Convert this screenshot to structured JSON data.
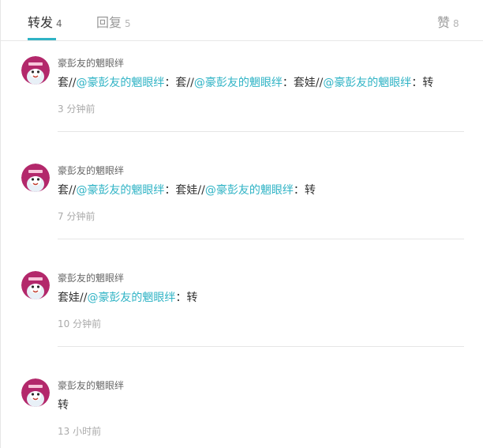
{
  "tabs": {
    "forward": {
      "label": "转发",
      "count": "4"
    },
    "reply": {
      "label": "回复",
      "count": "5"
    },
    "like": {
      "label": "赞",
      "count": "8"
    }
  },
  "accent_color": "#2fb3c5",
  "items": [
    {
      "username": "豪彭友的魍眼绊",
      "content": [
        {
          "t": "text",
          "v": "套//"
        },
        {
          "t": "mention",
          "v": "@豪彭友的魍眼绊"
        },
        {
          "t": "text",
          "v": "：套//"
        },
        {
          "t": "mention",
          "v": "@豪彭友的魍眼绊"
        },
        {
          "t": "text",
          "v": "：套娃//"
        },
        {
          "t": "mention",
          "v": "@豪彭友的魍眼绊"
        },
        {
          "t": "text",
          "v": "：转"
        }
      ],
      "time": "3 分钟前"
    },
    {
      "username": "豪彭友的魍眼绊",
      "content": [
        {
          "t": "text",
          "v": "套//"
        },
        {
          "t": "mention",
          "v": "@豪彭友的魍眼绊"
        },
        {
          "t": "text",
          "v": "：套娃//"
        },
        {
          "t": "mention",
          "v": "@豪彭友的魍眼绊"
        },
        {
          "t": "text",
          "v": "：转"
        }
      ],
      "time": "7 分钟前"
    },
    {
      "username": "豪彭友的魍眼绊",
      "content": [
        {
          "t": "text",
          "v": "套娃//"
        },
        {
          "t": "mention",
          "v": "@豪彭友的魍眼绊"
        },
        {
          "t": "text",
          "v": "：转"
        }
      ],
      "time": "10 分钟前"
    },
    {
      "username": "豪彭友的魍眼绊",
      "content": [
        {
          "t": "text",
          "v": "转"
        }
      ],
      "time": "13 小时前"
    }
  ]
}
